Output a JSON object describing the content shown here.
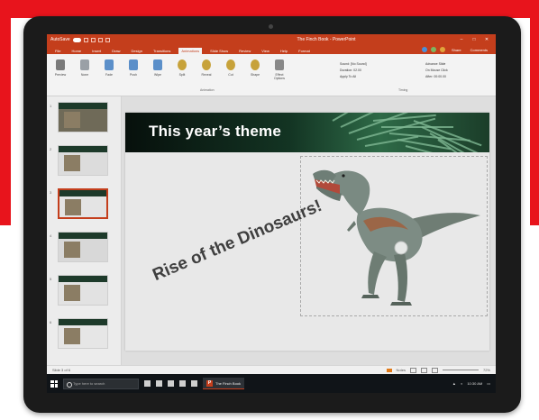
{
  "window": {
    "autosave_label": "AutoSave",
    "title": "The Finch Book - PowerPoint",
    "minimize": "–",
    "maximize": "□",
    "close": "✕"
  },
  "tabs": [
    "File",
    "Home",
    "Insert",
    "Draw",
    "Design",
    "Transitions",
    "Animations",
    "Slide Show",
    "Review",
    "View",
    "Help",
    "Format"
  ],
  "active_tab_index": 6,
  "tab_share": "Share",
  "tab_comments": "Comments",
  "ribbon": {
    "items": [
      "Preview",
      "None",
      "Fade",
      "Push",
      "Wipe",
      "Split",
      "Reveal",
      "Cut",
      "Shape",
      "Effect Options"
    ],
    "group_animation": "Animation",
    "group_timing": "Timing",
    "timing_left": [
      "Sound: [No Sound]",
      "Duration: 02.00",
      "Apply To All"
    ],
    "timing_right": [
      "Advance Slide",
      "On Mouse Click",
      "After: 00:00.00"
    ]
  },
  "slides": {
    "count": 6,
    "selected_index": 3,
    "numbers": [
      "1",
      "2",
      "3",
      "4",
      "5",
      "6"
    ]
  },
  "slide": {
    "title": "This year’s theme",
    "tagline": "Rise of the Dinosaurs!"
  },
  "status": {
    "left": "Slide 3 of 6",
    "right": "Notes",
    "zoom": "72%"
  },
  "taskbar": {
    "search_placeholder": "Type here to search",
    "app_label": "The Finch Book",
    "time": "10:30 AM"
  },
  "colors": {
    "brand": "#c43e1c",
    "frame": "#e8141c"
  }
}
